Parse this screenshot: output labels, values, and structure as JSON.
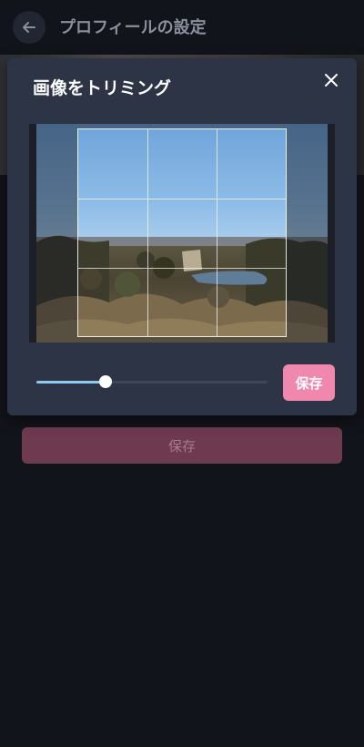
{
  "page": {
    "title": "プロフィールの設定",
    "back_icon": "arrow-left-icon",
    "save_label": "保存"
  },
  "modal": {
    "title": "画像をトリミング",
    "close_icon": "close-icon",
    "save_label": "保存",
    "zoom": 0.3
  },
  "colors": {
    "background": "#12141b",
    "modal_bg": "#2d3446",
    "accent_pink": "#f087ac",
    "slider_fill": "#8fc7ef"
  }
}
